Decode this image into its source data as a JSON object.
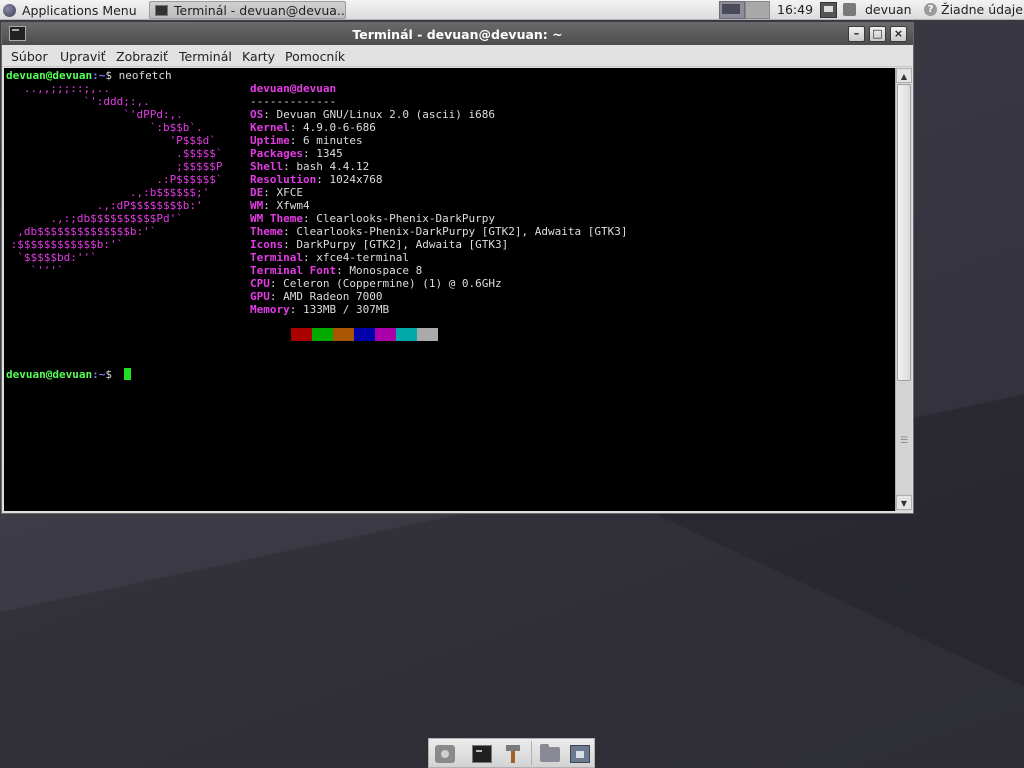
{
  "top_panel": {
    "apps_menu_label": "Applications Menu",
    "task_label": "Terminál - devuan@devua...",
    "clock": "16:49",
    "user": "devuan",
    "weather": "Žiadne údaje"
  },
  "window": {
    "title": "Terminál - devuan@devuan: ~",
    "min_label": "–",
    "max_label": "□",
    "close_label": "×"
  },
  "menubar": [
    "Súbor",
    "Upraviť",
    "Zobraziť",
    "Terminál",
    "Karty",
    "Pomocník"
  ],
  "terminal": {
    "prompt_host": "devuan@devuan",
    "prompt_path": ":~",
    "prompt_symbol": "$",
    "command": " neofetch",
    "logo_lines": [
      "   ..,,;;;::;,..",
      "            `':ddd;:,.",
      "                  `'dPPd:,.",
      "                      `:b$$b`.",
      "                         'P$$$d`",
      "                          .$$$$$`",
      "                          ;$$$$$P",
      "                       .:P$$$$$$`",
      "                   .,:b$$$$$$;'",
      "              .,:dP$$$$$$$$b:'",
      "       .,:;db$$$$$$$$$$Pd'`",
      "  ,db$$$$$$$$$$$$$$b:'`",
      " :$$$$$$$$$$$$b:'`",
      "  `$$$$$bd:''`",
      "    `'''`"
    ],
    "header": "devuan@devuan",
    "separator": "-------------",
    "info": [
      {
        "key": "OS",
        "value": "Devuan GNU/Linux 2.0 (ascii) i686"
      },
      {
        "key": "Kernel",
        "value": "4.9.0-6-686"
      },
      {
        "key": "Uptime",
        "value": "6 minutes"
      },
      {
        "key": "Packages",
        "value": "1345"
      },
      {
        "key": "Shell",
        "value": "bash 4.4.12"
      },
      {
        "key": "Resolution",
        "value": "1024x768"
      },
      {
        "key": "DE",
        "value": "XFCE"
      },
      {
        "key": "WM",
        "value": "Xfwm4"
      },
      {
        "key": "WM Theme",
        "value": "Clearlooks-Phenix-DarkPurpy"
      },
      {
        "key": "Theme",
        "value": "Clearlooks-Phenix-DarkPurpy [GTK2], Adwaita [GTK3]"
      },
      {
        "key": "Icons",
        "value": "DarkPurpy [GTK2], Adwaita [GTK3]"
      },
      {
        "key": "Terminal",
        "value": "xfce4-terminal"
      },
      {
        "key": "Terminal Font",
        "value": "Monospace 8"
      },
      {
        "key": "CPU",
        "value": "Celeron (Coppermine) (1) @ 0.6GHz"
      },
      {
        "key": "GPU",
        "value": "AMD Radeon 7000"
      },
      {
        "key": "Memory",
        "value": "133MB / 307MB"
      }
    ],
    "palette": [
      "#000000",
      "#aa0000",
      "#00aa00",
      "#aa5500",
      "#0000aa",
      "#aa00aa",
      "#00aaaa",
      "#aaaaaa"
    ]
  },
  "dock_icons": [
    "camera-icon",
    "terminal-icon",
    "tool-icon",
    "folder-icon",
    "screenshot-icon"
  ]
}
